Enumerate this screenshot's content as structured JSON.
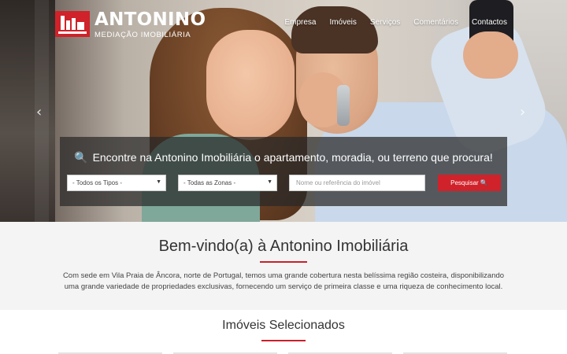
{
  "brand": {
    "name": "ANTONINO",
    "subtitle": "MEDIAÇÃO IMOBILIÁRIA",
    "accent": "#d0222a"
  },
  "nav": [
    "Empresa",
    "Imóveis",
    "Serviços",
    "Comentários",
    "Contactos"
  ],
  "hero": {
    "arrow_left": "‹",
    "arrow_right": "›"
  },
  "search": {
    "title": "Encontre na Antonino Imobiliária o apartamento, moradia, ou terreno que procura!",
    "type_select": "- Todos os Tipos -",
    "zone_select": "- Todas as Zonas -",
    "input_placeholder": "Nome ou referência do imóvel",
    "button_label": "Pesquisar"
  },
  "welcome": {
    "title": "Bem-vindo(a) à Antonino Imobiliária",
    "text": "Com sede em Vila Praia de Âncora, norte de Portugal, temos uma grande cobertura nesta belíssima região costeira, disponibilizando uma grande variedade de propriedades exclusivas, fornecendo um serviço de primeira classe e uma riqueza de conhecimento local."
  },
  "featured": {
    "title": "Imóveis Selecionados"
  }
}
